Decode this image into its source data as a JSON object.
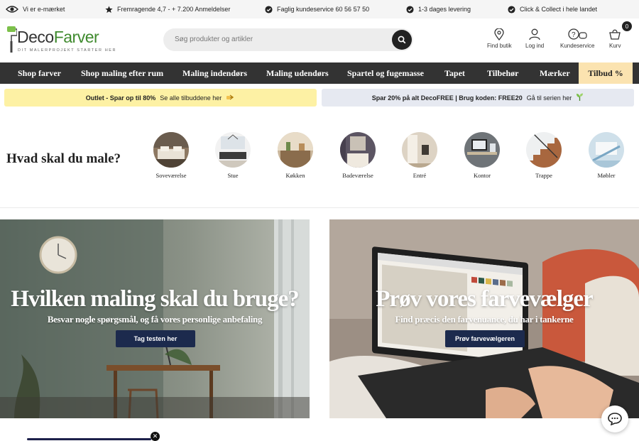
{
  "topbar": {
    "items": [
      {
        "icon": "eye-icon",
        "label": "Vi er e-mærket"
      },
      {
        "icon": "star-icon",
        "label": "Fremragende 4,7 - + 7.200 Anmeldelser"
      },
      {
        "icon": "check-circle-icon",
        "label": "Faglig kundeservice 60 56 57 50"
      },
      {
        "icon": "check-circle-icon",
        "label": "1-3 dages levering"
      },
      {
        "icon": "check-circle-icon",
        "label": "Click & Collect i hele landet"
      }
    ]
  },
  "header": {
    "logo_deco": "Deco",
    "logo_farver": "Farver",
    "logo_tagline": "DIT MALERPROJEKT STARTER HER",
    "search_placeholder": "Søg produkter og artikler",
    "actions": [
      {
        "icon": "location-pin-icon",
        "label": "Find butik"
      },
      {
        "icon": "user-icon",
        "label": "Log ind"
      },
      {
        "icon": "support-icon",
        "label": "Kundeservice"
      },
      {
        "icon": "basket-icon",
        "label": "Kurv"
      }
    ],
    "cart_count": "0"
  },
  "nav": {
    "items": [
      "Shop farver",
      "Shop maling efter rum",
      "Maling indendørs",
      "Maling udendørs",
      "Spartel og fugemasse",
      "Tapet",
      "Tilbehør",
      "Mærker"
    ],
    "tilbud": "Tilbud %"
  },
  "promos": [
    {
      "bold": "Outlet - Spar op til 80%",
      "link": "Se alle tilbuddene her",
      "bg": "#fdf1a4",
      "icon": "pointing-hand-icon"
    },
    {
      "bold": "Spar 20% på alt DecoFREE | Brug koden: FREE20",
      "link": "Gå til serien her",
      "bg": "#e6e9f1",
      "icon": "sprout-icon"
    }
  ],
  "categories": {
    "title": "Hvad skal du male?",
    "items": [
      "Soveværelse",
      "Stue",
      "Køkken",
      "Badeværelse",
      "Entré",
      "Kontor",
      "Trappe",
      "Møbler"
    ]
  },
  "banners": [
    {
      "title": "Hvilken maling skal du bruge?",
      "subtitle": "Besvar nogle spørgsmål, og få vores personlige anbefaling",
      "button": "Tag testen her"
    },
    {
      "title": "Prøv vores farvevælger",
      "subtitle": "Find præcis den farvenuance, du har i tankerne",
      "button": "Prøv farvevælgeren"
    }
  ],
  "colors": {
    "accent": "#3f8a2e",
    "nav_bg": "#333333",
    "tilbud_bg": "#fbe3b0",
    "button_bg": "#1c2a4d"
  }
}
